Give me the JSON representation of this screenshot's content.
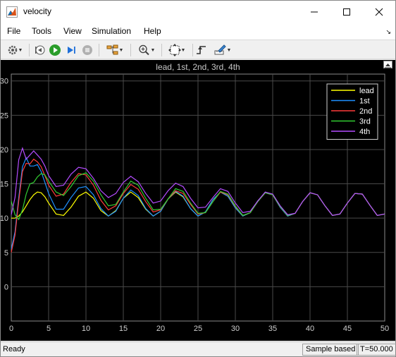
{
  "window": {
    "title": "velocity"
  },
  "menu": {
    "file": "File",
    "tools": "Tools",
    "view": "View",
    "simulation": "Simulation",
    "help": "Help"
  },
  "status": {
    "ready": "Ready",
    "mode": "Sample based",
    "time": "T=50.000"
  },
  "colors": {
    "lead": "#ffff00",
    "first": "#1e90ff",
    "second": "#ff3b3b",
    "third": "#32cd32",
    "fourth": "#b44cff",
    "axes_bg": "#000000",
    "grid": "#4a4a4a"
  },
  "chart_data": {
    "type": "line",
    "title": "lead, 1st, 2nd, 3rd, 4th",
    "xlabel": "",
    "ylabel": "",
    "xlim": [
      0,
      50
    ],
    "ylim": [
      -5,
      31
    ],
    "xticks": [
      0,
      5,
      10,
      15,
      20,
      25,
      30,
      35,
      40,
      45,
      50
    ],
    "yticks": [
      0,
      5,
      10,
      15,
      20,
      25,
      30
    ],
    "grid": true,
    "legend_position": "top-right",
    "series": [
      {
        "name": "lead",
        "color": "#ffff00",
        "x": [
          0,
          0.5,
          1.0,
          1.5,
          2.0,
          2.5,
          3.0,
          3.5,
          4.0,
          4.5,
          5.0,
          6.0,
          7.0,
          8.0,
          9.0,
          10.0,
          11.0,
          12.0,
          13.0,
          14.0,
          15.0,
          16.0,
          17.0,
          18.0,
          19.0,
          20.0,
          21.0,
          22.0,
          23.0,
          24.0,
          25.0,
          26.0,
          27.0,
          28.0,
          29.0,
          30.0,
          31.0,
          32.0,
          33.0,
          34.0,
          35.0,
          36.0,
          37.0,
          38.0,
          39.0,
          40.0,
          41.0,
          42.0,
          43.0,
          44.0,
          45.0,
          46.0,
          47.0,
          48.0,
          49.0,
          50.0
        ],
        "y": [
          10,
          10,
          10.3,
          10.9,
          11.8,
          12.7,
          13.4,
          13.8,
          13.7,
          13.1,
          12.2,
          10.6,
          10.4,
          11.6,
          13.2,
          13.8,
          12.9,
          11.1,
          10.3,
          11.1,
          12.9,
          13.8,
          13.0,
          11.3,
          10.3,
          11.0,
          12.8,
          13.8,
          13.1,
          11.4,
          10.3,
          10.9,
          12.7,
          13.8,
          13.2,
          11.5,
          10.3,
          10.8,
          12.5,
          13.7,
          13.4,
          11.6,
          10.3,
          10.7,
          12.4,
          13.7,
          13.4,
          11.8,
          10.4,
          10.6,
          12.2,
          13.6,
          13.5,
          11.9,
          10.4,
          10.6
        ]
      },
      {
        "name": "1st",
        "color": "#1e90ff",
        "x": [
          0,
          0.5,
          1.0,
          1.5,
          2.0,
          2.5,
          3.0,
          3.5,
          4.0,
          4.5,
          5.0,
          6.0,
          7.0,
          8.0,
          9.0,
          10.0,
          11.0,
          12.0,
          13.0,
          14.0,
          15.0,
          16.0,
          17.0,
          18.0,
          19.0,
          20.0,
          21.0,
          22.0,
          23.0,
          24.0,
          25.0,
          26.0,
          27.0,
          28.0,
          29.0,
          30.0,
          31.0,
          32.0,
          33.0,
          34.0,
          35.0,
          36.0,
          37.0,
          38.0,
          39.0,
          40.0,
          41.0,
          42.0,
          43.0,
          44.0,
          45.0,
          46.0,
          47.0,
          48.0,
          49.0,
          50.0
        ],
        "y": [
          5.5,
          8.0,
          13.0,
          17.5,
          18.8,
          17.6,
          17.6,
          17.8,
          16.8,
          15.2,
          13.6,
          11.3,
          11.3,
          13.0,
          14.4,
          14.6,
          13.4,
          11.4,
          10.3,
          11.0,
          12.9,
          14.1,
          13.3,
          11.4,
          10.3,
          11.0,
          12.8,
          13.9,
          13.2,
          11.4,
          10.3,
          10.9,
          12.7,
          13.8,
          13.2,
          11.5,
          10.3,
          10.8,
          12.5,
          13.7,
          13.4,
          11.6,
          10.3,
          10.7,
          12.4,
          13.7,
          13.4,
          11.8,
          10.4,
          10.6,
          12.2,
          13.6,
          13.5,
          11.9,
          10.4,
          10.6
        ]
      },
      {
        "name": "2nd",
        "color": "#ff3b3b",
        "x": [
          0,
          0.5,
          1.0,
          1.5,
          2.0,
          2.5,
          3.0,
          3.5,
          4.0,
          4.5,
          5.0,
          6.0,
          7.0,
          8.0,
          9.0,
          10.0,
          11.0,
          12.0,
          13.0,
          14.0,
          15.0,
          16.0,
          17.0,
          18.0,
          19.0,
          20.0,
          21.0,
          22.0,
          23.0,
          24.0,
          25.0,
          26.0,
          27.0,
          28.0,
          29.0,
          30.0,
          31.0,
          32.0,
          33.0,
          34.0,
          35.0,
          36.0,
          37.0,
          38.0,
          39.0,
          40.0,
          41.0,
          42.0,
          43.0,
          44.0,
          45.0,
          46.0,
          47.0,
          48.0,
          49.0,
          50.0
        ],
        "y": [
          5.0,
          7.5,
          12.5,
          16.8,
          18.0,
          17.9,
          18.6,
          18.2,
          17.5,
          16.2,
          14.8,
          13.2,
          13.5,
          15.2,
          16.5,
          16.3,
          14.8,
          12.6,
          11.2,
          11.8,
          13.6,
          14.9,
          14.2,
          12.4,
          10.9,
          11.2,
          12.8,
          14.0,
          13.6,
          12.0,
          10.6,
          10.8,
          12.4,
          13.8,
          13.4,
          11.7,
          10.4,
          10.8,
          12.4,
          13.7,
          13.4,
          11.7,
          10.4,
          10.7,
          12.4,
          13.7,
          13.4,
          11.8,
          10.4,
          10.6,
          12.2,
          13.6,
          13.5,
          11.9,
          10.4,
          10.6
        ]
      },
      {
        "name": "3rd",
        "color": "#32cd32",
        "x": [
          0,
          0.5,
          1.0,
          1.5,
          2.0,
          2.5,
          3.0,
          3.5,
          4.0,
          4.5,
          5.0,
          6.0,
          7.0,
          8.0,
          9.0,
          10.0,
          11.0,
          12.0,
          13.0,
          14.0,
          15.0,
          16.0,
          17.0,
          18.0,
          19.0,
          20.0,
          21.0,
          22.0,
          23.0,
          24.0,
          25.0,
          26.0,
          27.0,
          28.0,
          29.0,
          30.0,
          31.0,
          32.0,
          33.0,
          34.0,
          35.0,
          36.0,
          37.0,
          38.0,
          39.0,
          40.0,
          41.0,
          42.0,
          43.0,
          44.0,
          45.0,
          46.0,
          47.0,
          48.0,
          49.0,
          50.0
        ],
        "y": [
          12.5,
          10.5,
          9.8,
          11.2,
          13.5,
          15.0,
          15.2,
          16.0,
          16.5,
          16.3,
          15.4,
          13.8,
          13.3,
          14.6,
          16.2,
          16.6,
          15.4,
          13.4,
          11.8,
          12.0,
          13.8,
          15.4,
          14.8,
          12.9,
          11.2,
          11.3,
          12.8,
          14.3,
          13.9,
          12.2,
          10.7,
          10.8,
          12.4,
          13.9,
          13.5,
          11.8,
          10.4,
          10.8,
          12.4,
          13.7,
          13.4,
          11.7,
          10.4,
          10.7,
          12.4,
          13.7,
          13.4,
          11.8,
          10.4,
          10.6,
          12.2,
          13.6,
          13.5,
          11.9,
          10.4,
          10.6
        ]
      },
      {
        "name": "4th",
        "color": "#b44cff",
        "x": [
          0,
          0.5,
          1.0,
          1.5,
          2.0,
          2.5,
          3.0,
          3.5,
          4.0,
          4.5,
          5.0,
          6.0,
          7.0,
          8.0,
          9.0,
          10.0,
          11.0,
          12.0,
          13.0,
          14.0,
          15.0,
          16.0,
          17.0,
          18.0,
          19.0,
          20.0,
          21.0,
          22.0,
          23.0,
          24.0,
          25.0,
          26.0,
          27.0,
          28.0,
          29.0,
          30.0,
          31.0,
          32.0,
          33.0,
          34.0,
          35.0,
          36.0,
          37.0,
          38.0,
          39.0,
          40.0,
          41.0,
          42.0,
          43.0,
          44.0,
          45.0,
          46.0,
          47.0,
          48.0,
          49.0,
          50.0
        ],
        "y": [
          10.5,
          13.0,
          18.5,
          20.2,
          18.6,
          19.2,
          19.8,
          19.2,
          18.6,
          17.6,
          16.2,
          14.6,
          14.8,
          16.4,
          17.4,
          17.2,
          15.8,
          14.0,
          13.0,
          13.6,
          15.2,
          16.1,
          15.3,
          13.6,
          12.2,
          12.5,
          14.0,
          15.1,
          14.6,
          12.9,
          11.5,
          11.6,
          13.0,
          14.3,
          13.9,
          12.2,
          10.8,
          11.0,
          12.5,
          13.8,
          13.5,
          11.8,
          10.5,
          10.7,
          12.4,
          13.7,
          13.4,
          11.8,
          10.4,
          10.6,
          12.2,
          13.6,
          13.5,
          11.9,
          10.4,
          10.6
        ]
      }
    ]
  }
}
